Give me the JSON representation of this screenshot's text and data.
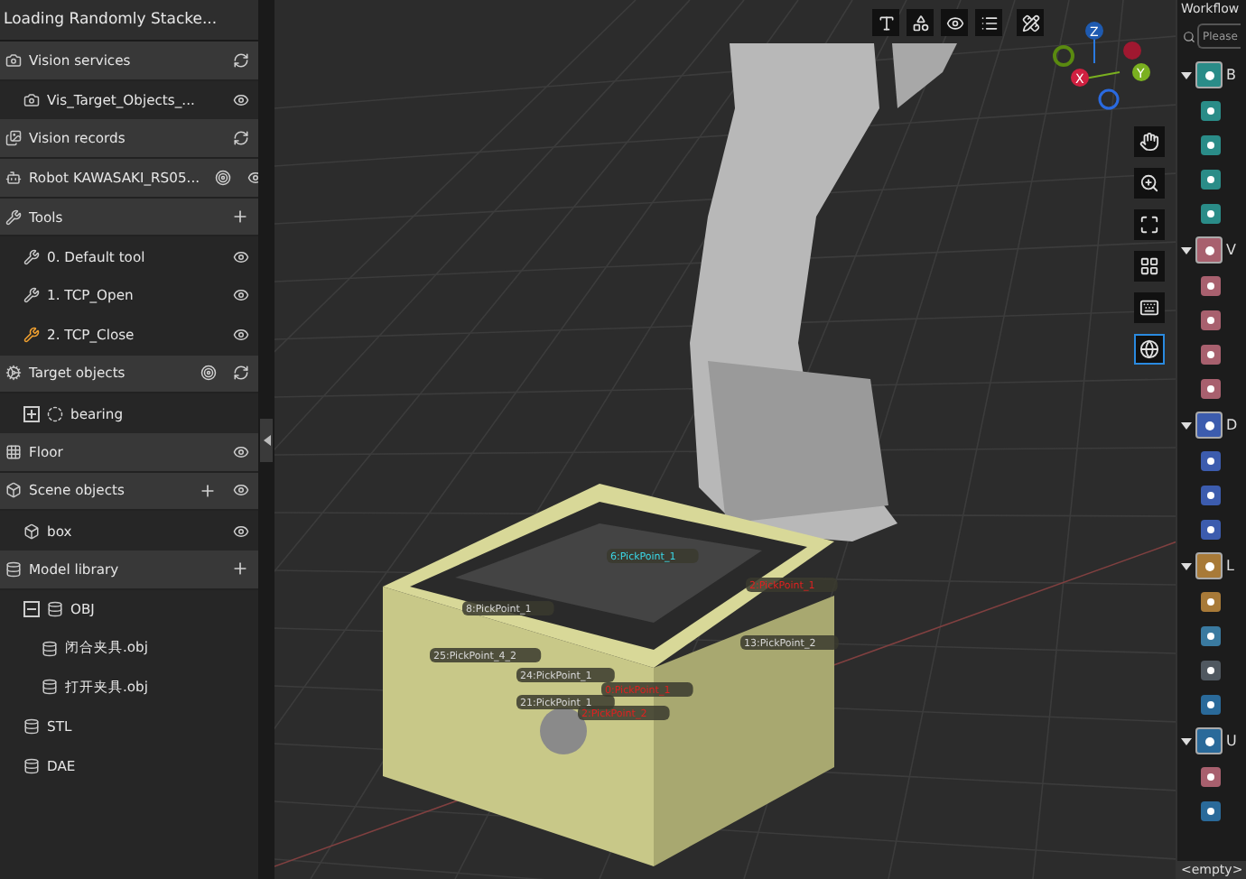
{
  "project": {
    "title": "Loading Randomly Stacke..."
  },
  "tree": [
    {
      "kind": "section",
      "label": "Vision services",
      "children": [
        {
          "kind": "item",
          "label": "Vis_Target_Objects_..."
        }
      ]
    },
    {
      "kind": "section",
      "label": "Vision records"
    },
    {
      "kind": "section",
      "label": "Robot KAWASAKI_RS05..."
    },
    {
      "kind": "section",
      "label": "Tools",
      "children": [
        {
          "kind": "item",
          "label": "0. Default tool",
          "selected": false
        },
        {
          "kind": "item",
          "label": "1. TCP_Open",
          "selected": false
        },
        {
          "kind": "item",
          "label": "2. TCP_Close",
          "selected": true
        }
      ]
    },
    {
      "kind": "section",
      "label": "Target objects",
      "children": [
        {
          "kind": "item",
          "label": "bearing",
          "expanded": false
        }
      ]
    },
    {
      "kind": "section",
      "label": "Floor"
    },
    {
      "kind": "section",
      "label": "Scene objects",
      "children": [
        {
          "kind": "item",
          "label": "box"
        }
      ]
    },
    {
      "kind": "section",
      "label": "Model library",
      "children": [
        {
          "kind": "item",
          "label": "OBJ",
          "expanded": true,
          "children": [
            {
              "kind": "item",
              "label": "闭合夹具.obj"
            },
            {
              "kind": "item",
              "label": "打开夹具.obj"
            }
          ]
        },
        {
          "kind": "item",
          "label": "STL"
        },
        {
          "kind": "item",
          "label": "DAE"
        }
      ]
    }
  ],
  "viewport": {
    "gizmo": {
      "z": "Z",
      "x": "X",
      "y": "Y"
    },
    "pick_points": [
      {
        "label": "6:PickPoint_1",
        "color": "#3ad8e8"
      },
      {
        "label": "2:PickPoint_1",
        "color": "#e02020"
      },
      {
        "label": "8:PickPoint_1",
        "color": "#d8d8d8"
      },
      {
        "label": "13:PickPoint_2",
        "color": "#d8d8d8"
      },
      {
        "label": "25:PickPoint_4_2",
        "color": "#d8d8d8"
      },
      {
        "label": "24:PickPoint_1",
        "color": "#d8d8d8"
      },
      {
        "label": "21:PickPoint_1",
        "color": "#d8d8d8"
      },
      {
        "label": "0:PickPoint_1",
        "color": "#e02020"
      },
      {
        "label": "2:PickPoint_2",
        "color": "#e02020"
      }
    ],
    "side_tools": [
      {
        "kind": "pan",
        "selected": false
      },
      {
        "kind": "zoom",
        "selected": false
      },
      {
        "kind": "fit",
        "selected": false
      },
      {
        "kind": "grid",
        "selected": false
      },
      {
        "kind": "keyboard",
        "selected": false
      },
      {
        "kind": "globe",
        "selected": true
      }
    ]
  },
  "workflow": {
    "title": "Workflow",
    "search": {
      "placeholder": "Please"
    },
    "groups": [
      {
        "label": "B",
        "color": "#2a8c88",
        "steps": [
          {
            "color": "#2a8c88"
          },
          {
            "color": "#2a8c88"
          },
          {
            "color": "#2a8c88"
          },
          {
            "color": "#2a8c88"
          }
        ]
      },
      {
        "label": "V",
        "color": "#a8606e",
        "steps": [
          {
            "color": "#a8606e"
          },
          {
            "color": "#a8606e"
          },
          {
            "color": "#a8606e"
          },
          {
            "color": "#a8606e"
          }
        ]
      },
      {
        "label": "D",
        "color": "#3c5cae",
        "steps": [
          {
            "color": "#3c5cae"
          },
          {
            "color": "#3c5cae"
          },
          {
            "color": "#3c5cae"
          }
        ]
      },
      {
        "label": "L",
        "color": "#a87a38",
        "steps": [
          {
            "color": "#a87a38"
          },
          {
            "color": "#3a7aa0"
          },
          {
            "color": "#505860"
          },
          {
            "color": "#2a6a9a"
          }
        ]
      },
      {
        "label": "U",
        "color": "#2a6a9a",
        "steps": [
          {
            "color": "#a8606e"
          },
          {
            "color": "#2a6a9a"
          }
        ]
      }
    ],
    "footer": "<empty>"
  }
}
